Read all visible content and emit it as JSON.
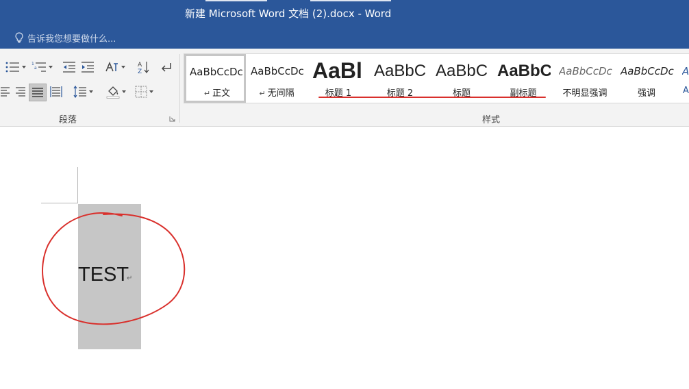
{
  "window": {
    "title": "新建 Microsoft Word 文档 (2).docx - Word",
    "tell_me_placeholder": "告诉我您想要做什么..."
  },
  "ribbon": {
    "groups": {
      "paragraph_label": "段落",
      "styles_label": "样式"
    },
    "styles": [
      {
        "preview": "AaBbCcDc",
        "name": "正文",
        "has_para_mark": true
      },
      {
        "preview": "AaBbCcDc",
        "name": "无间隔",
        "has_para_mark": true
      },
      {
        "preview": "AaBl",
        "name": "标题 1",
        "has_para_mark": false
      },
      {
        "preview": "AaBbC",
        "name": "标题 2",
        "has_para_mark": false
      },
      {
        "preview": "AaBbC",
        "name": "标题",
        "has_para_mark": false
      },
      {
        "preview": "AaBbC",
        "name": "副标题",
        "has_para_mark": false
      },
      {
        "preview": "AaBbCcDc",
        "name": "不明显强调",
        "has_para_mark": false
      },
      {
        "preview": "AaBbCcDc",
        "name": "强调",
        "has_para_mark": false
      },
      {
        "preview": "A",
        "name": "A",
        "has_para_mark": false
      }
    ]
  },
  "document": {
    "text": "TEST",
    "paragraph_mark": "↵"
  },
  "colors": {
    "titlebar": "#2b579a",
    "annotation": "#d9302c",
    "selection": "#c6c6c6"
  }
}
